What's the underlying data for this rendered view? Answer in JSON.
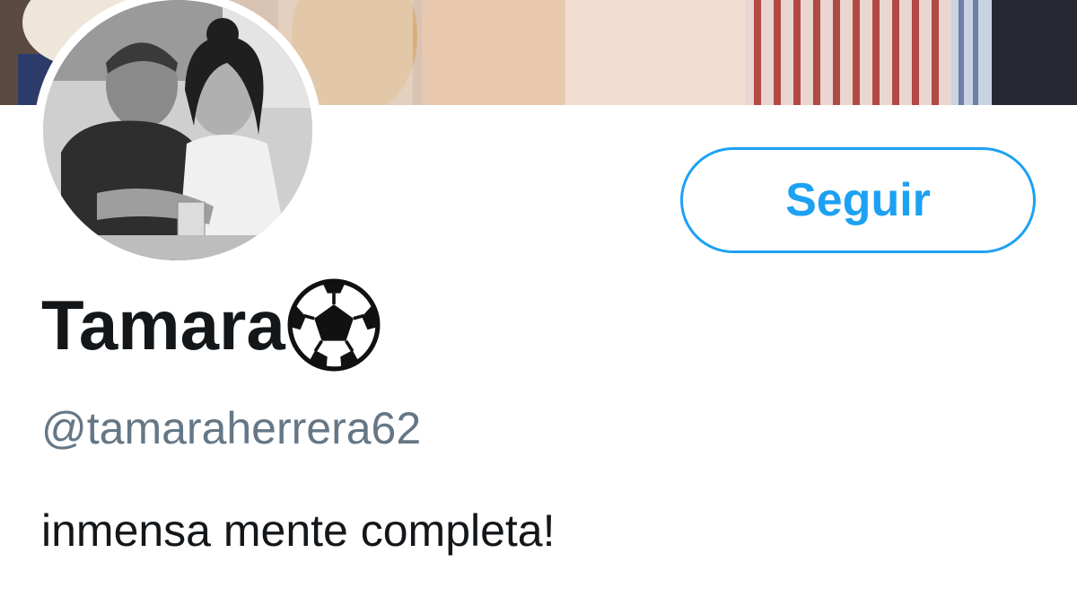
{
  "profile": {
    "display_name": "Tamara",
    "name_emoji_icon": "soccer-ball-icon",
    "handle": "@tamaraherrera62",
    "bio": "inmensa mente completa!",
    "follow_label": "Seguir"
  },
  "colors": {
    "accent": "#1da1f2",
    "name_text": "#14171a",
    "handle_text": "#657786",
    "background": "#ffffff"
  }
}
